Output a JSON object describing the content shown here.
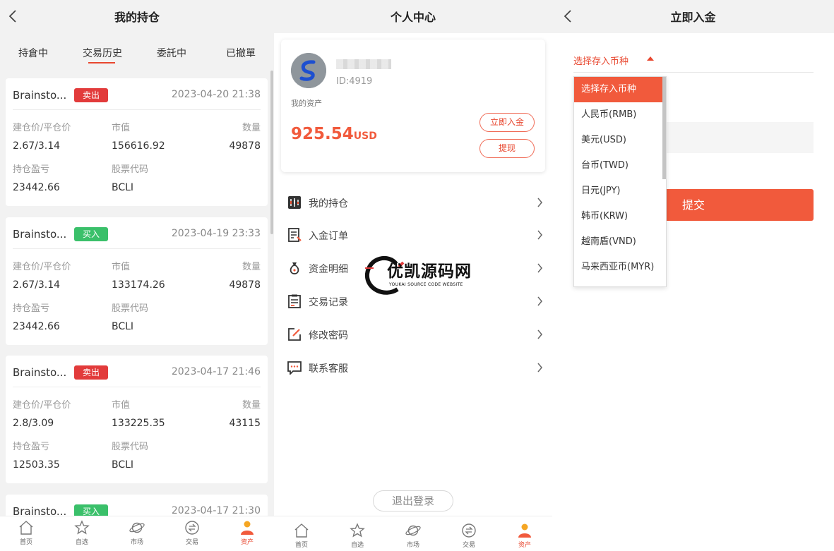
{
  "holdings": {
    "title": "我的持仓",
    "tabs": [
      "持倉中",
      "交易历史",
      "委託中",
      "已撤單"
    ],
    "active_tab": 1,
    "labels": {
      "open_close": "建仓价/平仓价",
      "market_value": "市值",
      "quantity": "数量",
      "pnl": "持仓盈亏",
      "code": "股票代码"
    },
    "cards": [
      {
        "name": "Brainsto...",
        "side": "卖出",
        "side_type": "sell",
        "time": "2023-04-20 21:38",
        "prices": "2.67/3.14",
        "market_value": "156616.92",
        "quantity": "49878",
        "pnl": "23442.66",
        "code": "BCLI"
      },
      {
        "name": "Brainsto...",
        "side": "买入",
        "side_type": "buy",
        "time": "2023-04-19 23:33",
        "prices": "2.67/3.14",
        "market_value": "133174.26",
        "quantity": "49878",
        "pnl": "23442.66",
        "code": "BCLI"
      },
      {
        "name": "Brainsto...",
        "side": "卖出",
        "side_type": "sell",
        "time": "2023-04-17 21:46",
        "prices": "2.8/3.09",
        "market_value": "133225.35",
        "quantity": "43115",
        "pnl": "12503.35",
        "code": "BCLI"
      },
      {
        "name": "Brainsto...",
        "side": "买入",
        "side_type": "buy",
        "time": "2023-04-17 21:30"
      }
    ]
  },
  "nav": {
    "items": [
      "首页",
      "自选",
      "市场",
      "交易",
      "资产"
    ],
    "active": 4
  },
  "profile": {
    "title": "个人中心",
    "user_id": "ID:4919",
    "asset_label": "我的资产",
    "asset_amount": "925.54",
    "asset_unit": "USD",
    "deposit_label": "立即入金",
    "withdraw_label": "提现",
    "menu": [
      {
        "label": "我的持仓",
        "icon": "holdings-chart-icon"
      },
      {
        "label": "入金订单",
        "icon": "deposit-order-icon"
      },
      {
        "label": "资金明细",
        "icon": "money-bag-icon"
      },
      {
        "label": "交易记录",
        "icon": "trade-record-icon"
      },
      {
        "label": "修改密码",
        "icon": "edit-password-icon"
      },
      {
        "label": "联系客服",
        "icon": "chat-support-icon"
      }
    ],
    "logout_label": "退出登录"
  },
  "watermark": {
    "name": "优凯源码网",
    "sub": "YOUKAI SOURCE CODE WEBSITE"
  },
  "deposit": {
    "title": "立即入金",
    "select_label": "选择存入币种",
    "submit_label": "提交",
    "options": [
      "选择存入币种",
      "人民币(RMB)",
      "美元(USD)",
      "台币(TWD)",
      "日元(JPY)",
      "韩币(KRW)",
      "越南盾(VND)",
      "马来西亚币(MYR)"
    ],
    "selected_index": 0
  },
  "colors": {
    "accent": "#f15a3c",
    "sell": "#e23b3b",
    "buy": "#3ac06a"
  }
}
